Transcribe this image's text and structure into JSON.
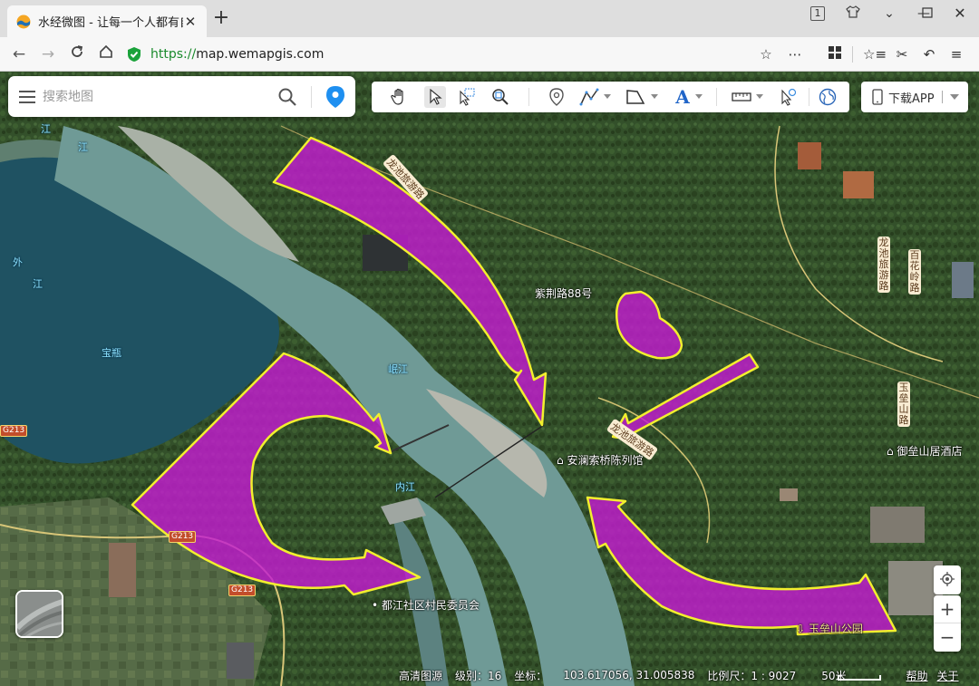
{
  "browser": {
    "tab_title": "水经微图 - 让每一个人都有自",
    "new_tab": "+",
    "url_scheme": "https://",
    "url_host": "map.wemapgis.com",
    "tab_count": "1"
  },
  "search": {
    "placeholder": "搜索地图"
  },
  "toolbar": {
    "tools": [
      "pan-tool",
      "select-tool",
      "box-select-tool",
      "zoom-box-tool",
      "marker-tool",
      "line-tool",
      "polygon-tool",
      "text-tool",
      "measure-tool",
      "query-tool",
      "globe-tool"
    ]
  },
  "app_button": {
    "label": "下载APP"
  },
  "map_labels": {
    "road_longchi_top": "龙池旅游路",
    "road_longchi_mid": "龙池旅游路",
    "road_longchi_right": "龙池旅游路",
    "road_baihua": "百花岭路",
    "road_yulei": "玉垒山路",
    "road_zisong": "紫荆路88号",
    "poi_museum": "安澜索桥陈列馆",
    "poi_hotel": "御垒山居酒店",
    "poi_village": "都江社区村民委员会",
    "poi_park": "玉垒山公园",
    "river_top": "江",
    "river_mid": "岷江",
    "river_inner": "内江",
    "river_left1": "外",
    "river_left2": "江",
    "river_lake": "宝瓶",
    "g213_a": "G213",
    "g213_b": "G213",
    "g213_c": "G213"
  },
  "status": {
    "source": "高清图源",
    "level_label": "级别：16",
    "coord_label": "坐标：",
    "coord_value": "103.617056, 31.005838",
    "scale_label": "比例尺：1 : 9027",
    "scale_bar": "50米",
    "help": "帮助",
    "about": "关于"
  },
  "colors": {
    "annotation_fill": "#c21ccf",
    "annotation_stroke": "#f2ef2e",
    "river": "#6f9a96",
    "reservoir": "#1d4f5e",
    "forest": "#2f4a24"
  }
}
